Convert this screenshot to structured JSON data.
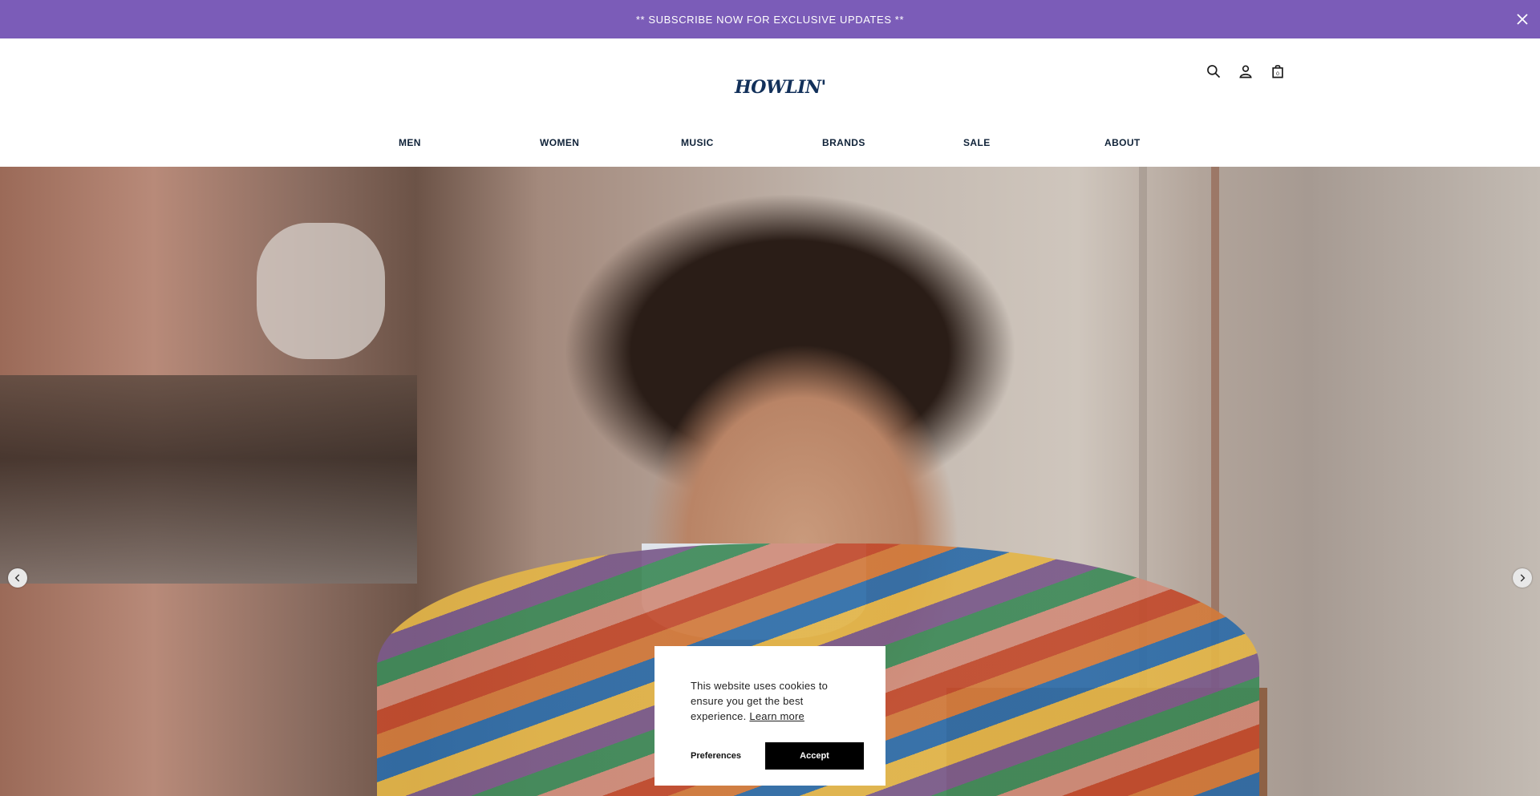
{
  "announcement": {
    "text": "** SUBSCRIBE NOW FOR EXCLUSIVE UPDATES **",
    "close_icon": "close-icon"
  },
  "header": {
    "logo_text": "HOWLIN'",
    "icons": [
      "search-icon",
      "account-icon",
      "cart-icon"
    ],
    "cart_count": "0"
  },
  "nav": {
    "items": [
      {
        "label": "MEN"
      },
      {
        "label": "WOMEN"
      },
      {
        "label": "MUSIC"
      },
      {
        "label": "BRANDS"
      },
      {
        "label": "SALE"
      },
      {
        "label": "ABOUT"
      }
    ]
  },
  "carousel": {
    "prev_icon": "chevron-left-icon",
    "next_icon": "chevron-right-icon"
  },
  "cookie": {
    "message": "This website uses cookies to ensure you get the best experience.",
    "learn_more": "Learn more",
    "preferences": "Preferences",
    "accept": "Accept"
  },
  "colors": {
    "announce_bg": "#7b5cb8",
    "nav_text": "#0f2238",
    "logo": "#12305a",
    "accept_bg": "#000000"
  }
}
